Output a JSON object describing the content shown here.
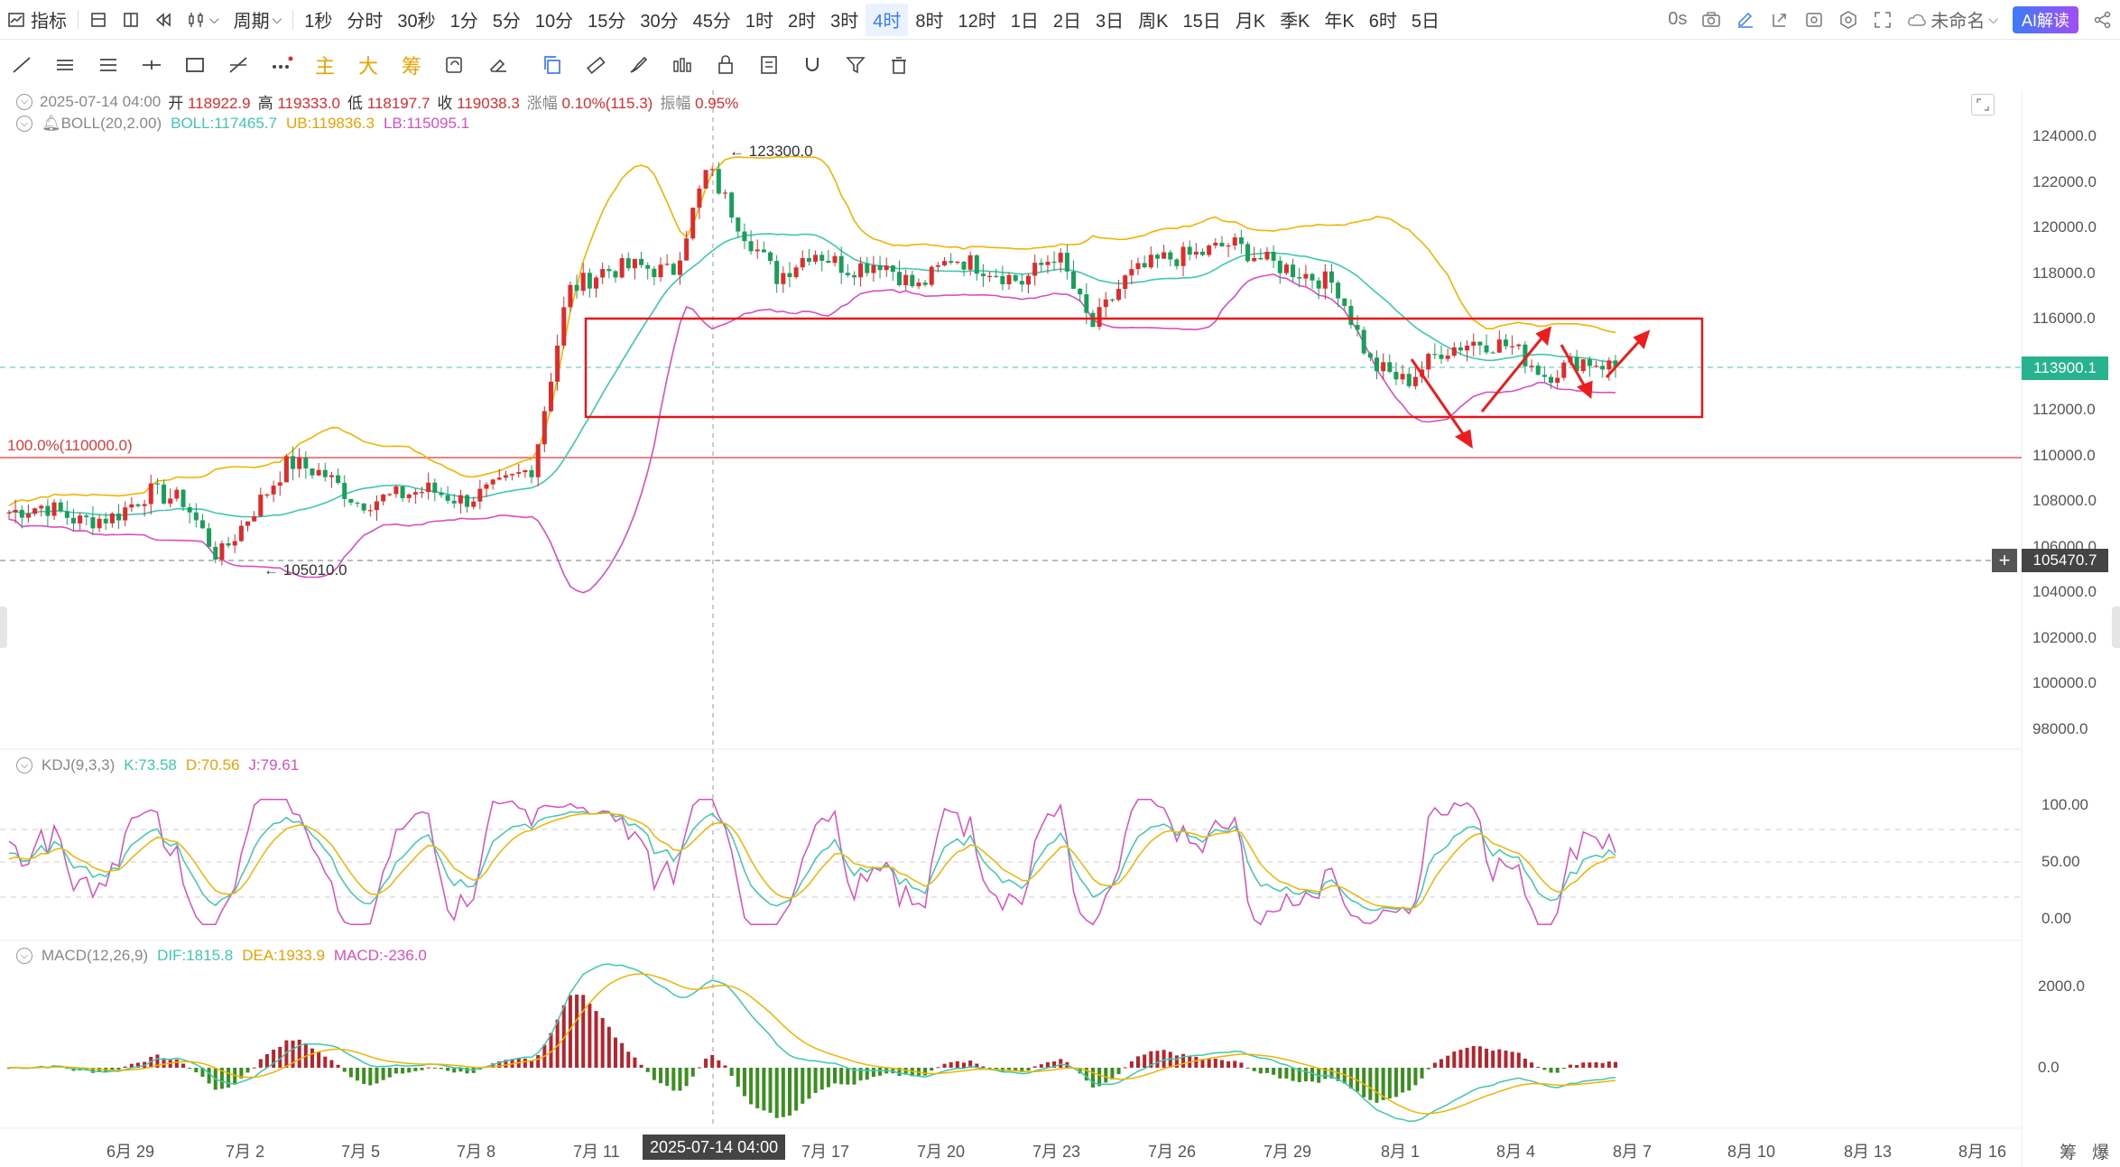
{
  "toolbar": {
    "indicator_label": "指标",
    "period_label": "周期",
    "periods": [
      "1秒",
      "分时",
      "30秒",
      "1分",
      "5分",
      "10分",
      "15分",
      "30分",
      "45分",
      "1时",
      "2时",
      "3时",
      "4时",
      "8时",
      "12时",
      "1日",
      "2日",
      "3日",
      "周K",
      "15日",
      "月K",
      "季K",
      "年K",
      "6时",
      "5日"
    ],
    "active_period": "4时",
    "delay": "0s",
    "layout_name": "未命名",
    "ai_button": "AI解读"
  },
  "drawbar": {
    "main_label": "主",
    "big_label": "大",
    "chip_label": "筹"
  },
  "ohlc": {
    "datetime": "2025-07-14 04:00",
    "open_label": "开",
    "open": "118922.9",
    "high_label": "高",
    "high": "119333.0",
    "low_label": "低",
    "low": "118197.7",
    "close_label": "收",
    "close": "119038.3",
    "change_label": "涨幅",
    "change": "0.10%(115.3)",
    "amp_label": "振幅",
    "amp": "0.95%"
  },
  "boll": {
    "name": "BOLL(20,2.00)",
    "mid": "BOLL:117465.7",
    "ub": "UB:119836.3",
    "lb": "LB:115095.1"
  },
  "kdj": {
    "name": "KDJ(9,3,3)",
    "k": "K:73.58",
    "d": "D:70.56",
    "j": "J:79.61"
  },
  "macd": {
    "name": "MACD(12,26,9)",
    "dif": "DIF:1815.8",
    "dea": "DEA:1933.9",
    "macd": "MACD:-236.0"
  },
  "annotations": {
    "high_mark": "123300.0",
    "low_mark": "105010.0",
    "fib_level": "100.0%(110000.0)"
  },
  "price_axis": [
    "124000.0",
    "122000.0",
    "120000.0",
    "118000.0",
    "116000.0",
    "114000.0",
    "112000.0",
    "110000.0",
    "108000.0",
    "106000.0",
    "104000.0",
    "102000.0",
    "100000.0",
    "98000.0"
  ],
  "current_price": "113900.1",
  "cursor_price": "105470.7",
  "kdj_axis": [
    "100.00",
    "50.00",
    "0.00"
  ],
  "macd_axis": [
    "2000.0",
    "0.0"
  ],
  "dates": [
    "6月 29",
    "7月 2",
    "7月 5",
    "7月 8",
    "7月 11",
    "7月 17",
    "7月 20",
    "7月 23",
    "7月 26",
    "7月 29",
    "8月 1",
    "8月 4",
    "8月 7",
    "8月 10",
    "8月 13",
    "8月 16"
  ],
  "cursor_date": "2025-07-14 04:00",
  "bottom_right": {
    "chip": "筹",
    "liq": "爆"
  },
  "colors": {
    "up": "#e02b2b",
    "down": "#18a05a",
    "boll_mid": "#3ec8b0",
    "boll_ub": "#f0b400",
    "boll_lb": "#d94fc0",
    "accent": "#3b7cf6"
  },
  "chart_data": {
    "type": "candlestick",
    "title": "",
    "ylim": [
      97000,
      125500
    ],
    "close_anchors": [
      107500,
      107800,
      107100,
      107300,
      108400,
      108000,
      105500,
      107600,
      109700,
      109200,
      107900,
      108200,
      108500,
      108000,
      108600,
      109500,
      117200,
      118100,
      118300,
      118000,
      122600,
      119900,
      117800,
      119000,
      118200,
      118500,
      117300,
      118700,
      118200,
      117600,
      118900,
      115600,
      117800,
      118600,
      118800,
      119300,
      118500,
      118000,
      117500,
      114000,
      113200,
      114600,
      115000,
      114800,
      113500,
      114200,
      113900
    ]
  }
}
